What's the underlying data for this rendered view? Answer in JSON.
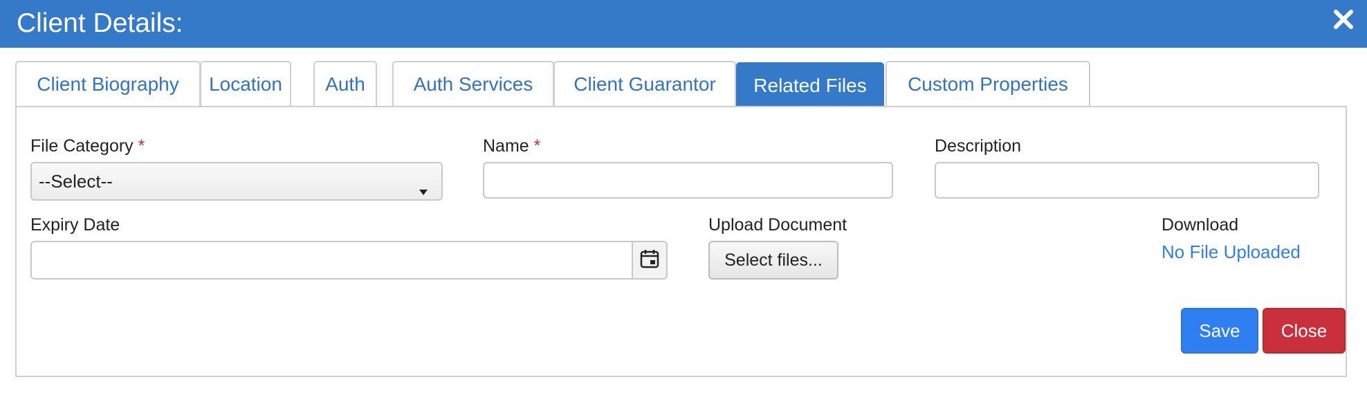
{
  "dialog": {
    "title": "Client Details:",
    "close_icon": "close-icon"
  },
  "tabs": [
    {
      "label": "Client Biography",
      "active": false
    },
    {
      "label": "Location",
      "active": false
    },
    {
      "label": "Auth",
      "active": false
    },
    {
      "label": "Auth Services",
      "active": false
    },
    {
      "label": "Client Guarantor",
      "active": false
    },
    {
      "label": "Related Files",
      "active": true
    },
    {
      "label": "Custom Properties",
      "active": false
    }
  ],
  "form": {
    "file_category": {
      "label": "File Category",
      "required_mark": "*",
      "selected": "--Select--"
    },
    "name": {
      "label": "Name",
      "required_mark": "*",
      "value": ""
    },
    "description": {
      "label": "Description",
      "value": ""
    },
    "expiry_date": {
      "label": "Expiry Date",
      "value": "",
      "icon": "calendar-icon"
    },
    "upload": {
      "label": "Upload Document",
      "button_label": "Select files..."
    },
    "download": {
      "label": "Download",
      "link_text": "No File Uploaded"
    }
  },
  "actions": {
    "save_label": "Save",
    "close_label": "Close"
  },
  "colors": {
    "header": "#3579c9",
    "tab_text": "#2f73c3",
    "save": "#2f7ef2",
    "close": "#c9303b",
    "required": "#d42a2a",
    "link": "#2f80e8"
  }
}
